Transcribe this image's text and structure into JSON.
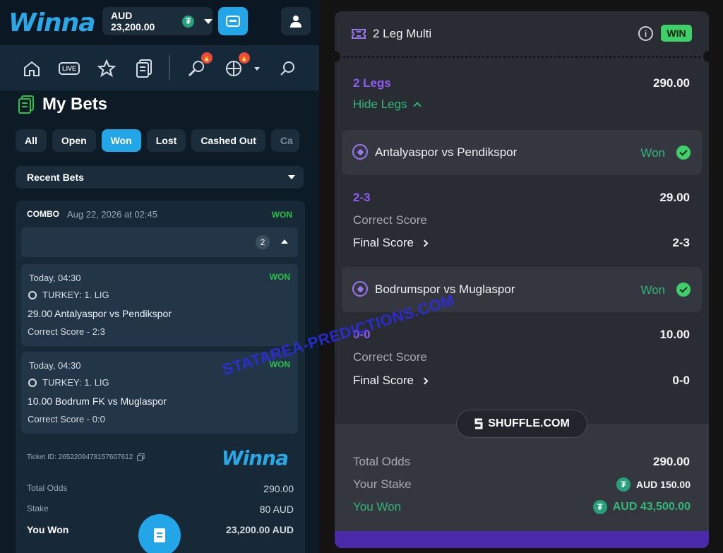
{
  "left": {
    "logo": "Winna",
    "balance": "AUD 23,200.00",
    "page_title": "My Bets",
    "filters": [
      {
        "label": "All"
      },
      {
        "label": "Open"
      },
      {
        "label": "Won"
      },
      {
        "label": "Lost"
      },
      {
        "label": "Cashed Out"
      },
      {
        "label": "Ca"
      }
    ],
    "active_filter": "Won",
    "recent_bets": "Recent Bets",
    "combo": {
      "tag": "COMBO",
      "date": "Aug 22, 2026 at 02:45",
      "status": "WON",
      "legs_count": "2"
    },
    "legs": [
      {
        "time": "Today, 04:30",
        "status": "WON",
        "league": "TURKEY: 1. LIG",
        "match": "29.00 Antalyaspor vs Pendikspor",
        "selection": "Correct Score - 2:3"
      },
      {
        "time": "Today, 04:30",
        "status": "WON",
        "league": "TURKEY: 1. LIG",
        "match": "10.00 Bodrum FK vs Muglaspor",
        "selection": "Correct Score - 0:0"
      }
    ],
    "ticket": "Ticket ID: 2652209478157607612",
    "summary": {
      "total_odds_label": "Total Odds",
      "total_odds": "290.00",
      "stake_label": "Stake",
      "stake": "80 AUD",
      "won_label": "You Won",
      "won": "23,200.00 AUD"
    }
  },
  "right": {
    "title": "2 Leg Multi",
    "badge": "WIN",
    "legs_label": "2 Legs",
    "legs_value": "290.00",
    "hide_legs": "Hide Legs",
    "matches": [
      {
        "teams": "Antalyaspor vs Pendikspor",
        "status": "Won",
        "score_pick": "2-3",
        "odds": "29.00",
        "market": "Correct Score",
        "final_label": "Final Score",
        "final": "2-3"
      },
      {
        "teams": "Bodrumspor vs Muglaspor",
        "status": "Won",
        "score_pick": "0-0",
        "odds": "10.00",
        "market": "Correct Score",
        "final_label": "Final Score",
        "final": "0-0"
      }
    ],
    "brand": "SHUFFLE.COM",
    "totals": {
      "odds_label": "Total Odds",
      "odds": "290.00",
      "stake_label": "Your Stake",
      "stake": "AUD 150.00",
      "won_label": "You Won",
      "won": "AUD 43,500.00"
    }
  },
  "watermark": "STATAREA-PREDICTIONS.COM",
  "colors": {
    "winna_blue": "#23a6e8",
    "won_green": "#29c34a",
    "shuffle_purple": "#8d5cf6",
    "shuffle_green": "#32b877"
  }
}
